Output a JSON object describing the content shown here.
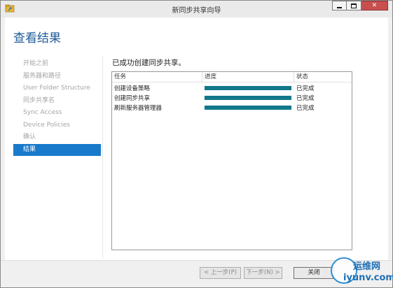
{
  "window": {
    "title": "新同步共享向导"
  },
  "page": {
    "title": "查看结果",
    "heading": "已成功创建同步共享。"
  },
  "nav": {
    "items": [
      {
        "label": "开始之前",
        "active": false
      },
      {
        "label": "服务器和路径",
        "active": false
      },
      {
        "label": "User Folder Structure",
        "active": false
      },
      {
        "label": "同步共享名",
        "active": false
      },
      {
        "label": "Sync Access",
        "active": false
      },
      {
        "label": "Device Policies",
        "active": false
      },
      {
        "label": "确认",
        "active": false
      },
      {
        "label": "结果",
        "active": true
      }
    ]
  },
  "results": {
    "columns": {
      "task": "任务",
      "progress": "进度",
      "status": "状态"
    },
    "rows": [
      {
        "task": "创建设备策略",
        "progress": 1.0,
        "status": "已完成"
      },
      {
        "task": "创建同步共享",
        "progress": 1.0,
        "status": "已完成"
      },
      {
        "task": "刷新服务器管理器",
        "progress": 1.0,
        "status": "已完成"
      }
    ]
  },
  "buttons": {
    "prev": "< 上一步(P)",
    "next": "下一步(N) >",
    "close": "关闭"
  },
  "watermark": {
    "line1": "运维网",
    "line2": "iyunv.com"
  },
  "colors": {
    "accent": "#1979ca",
    "progress": "#12788a",
    "title": "#1e5a9a",
    "close": "#c94f4f"
  },
  "icons": {
    "title": "wizard-share-icon",
    "min": "minimize-icon",
    "max": "maximize-icon",
    "close": "close-icon"
  }
}
